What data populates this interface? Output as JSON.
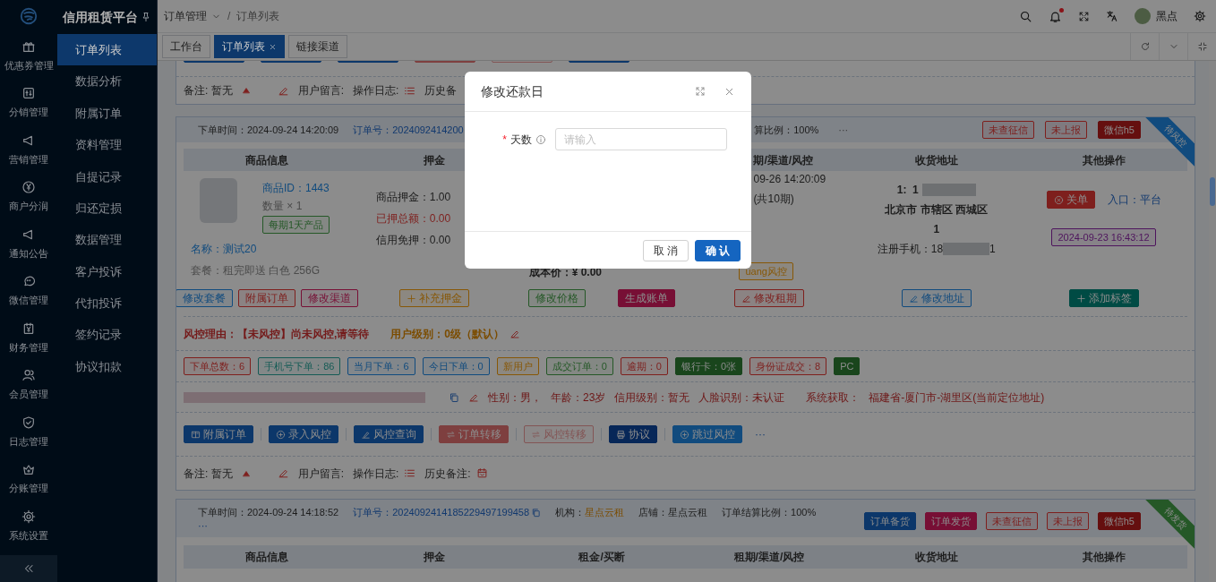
{
  "brand": {
    "title": "信用租赁平台"
  },
  "rail": [
    {
      "label": "优惠券管理"
    },
    {
      "label": "分销管理"
    },
    {
      "label": "营销管理"
    },
    {
      "label": "商户分润"
    },
    {
      "label": "通知公告"
    },
    {
      "label": "微信管理"
    },
    {
      "label": "财务管理"
    },
    {
      "label": "会员管理"
    },
    {
      "label": "日志管理"
    },
    {
      "label": "分账管理"
    },
    {
      "label": "系统设置"
    }
  ],
  "menu": [
    {
      "label": "订单列表",
      "selected": true
    },
    {
      "label": "数据分析",
      "selected": false
    },
    {
      "label": "附属订单",
      "selected": false
    },
    {
      "label": "资料管理",
      "selected": false
    },
    {
      "label": "自提记录",
      "selected": false
    },
    {
      "label": "归还定损",
      "selected": false
    },
    {
      "label": "数据管理",
      "selected": false
    },
    {
      "label": "客户投诉",
      "selected": false
    },
    {
      "label": "代扣投诉",
      "selected": false
    },
    {
      "label": "签约记录",
      "selected": false
    },
    {
      "label": "协议扣款",
      "selected": false
    }
  ],
  "breadcrumb": {
    "parent": "订单管理",
    "separator": "/",
    "current": "订单列表"
  },
  "notifications": {
    "unread": true
  },
  "user": {
    "name": "黑点"
  },
  "tabs": [
    {
      "label": "工作台",
      "selected": false
    },
    {
      "label": "订单列表",
      "selected": true
    },
    {
      "label": "链接渠道",
      "selected": false
    }
  ],
  "previous_order": {
    "buttons": [
      {
        "color": "#0c376a",
        "kind": "filled"
      },
      {
        "color": "#0c376a",
        "kind": "filled"
      },
      {
        "color": "#0c376a",
        "kind": "filled"
      },
      {
        "color": "#7e3f3f",
        "kind": "filled"
      },
      {
        "color": "#835555",
        "kind": "outline"
      },
      {
        "color": "#0c376a",
        "kind": "filled"
      }
    ],
    "remark": {
      "note": "备注: 暂无",
      "message": "用户留言:",
      "log": "操作日志:",
      "history": "历史备",
      "history_icon": false
    }
  },
  "order": {
    "header": {
      "time": "下单时间：2024-09-24 14:20:09",
      "number": "订单号：2024092414200",
      "ratio": "算比例：100%",
      "more": "···",
      "tags": [
        {
          "label": "未查征信",
          "color": "#7e1f1d",
          "kind": "outline"
        },
        {
          "label": "未上报",
          "color": "#7e1f1d",
          "kind": "outline"
        },
        {
          "label": "微信h5",
          "color": "#650f0f",
          "kind": "filled"
        }
      ],
      "ribbon": {
        "label": "待风控",
        "color": "#114b7e"
      }
    },
    "columns": {
      "column_1": "商品信息",
      "column_2": "押金",
      "column_4": "期/渠道/风控",
      "column_5": "收货地址",
      "column_6": "其他操作"
    },
    "product": {
      "id": "商品ID：1443",
      "quantity": "数量 × 1",
      "tag": {
        "label": "每期1天产品",
        "color": "#255827",
        "kind": "outline"
      },
      "name": "名称：测试20",
      "package": "套餐：租完即送 白色 256G",
      "buttons": [
        {
          "label": "修改套餐",
          "color": "#114b7e",
          "kind": "outline"
        },
        {
          "label": "附属订单",
          "color": "#7e1f1d",
          "kind": "outline"
        },
        {
          "label": "修改渠道",
          "color": "#770f35",
          "kind": "outline"
        }
      ]
    },
    "deposit": {
      "lines": [
        {
          "text": "商品押金：1.00",
          "alert": false
        },
        {
          "text": "已押总额：0.00",
          "alert": true
        },
        {
          "text": "信用免押：0.00",
          "alert": false
        }
      ],
      "buttons": [
        {
          "label": "补充押金",
          "color": "#875706",
          "kind": "outline"
        }
      ]
    },
    "rent": {
      "cost": "成本价：¥ 0.00",
      "buttons": [
        {
          "label": "修改价格",
          "color": "#255827",
          "kind": "outline"
        },
        {
          "label": "生成账单",
          "color": "#770f35",
          "kind": "filled"
        }
      ]
    },
    "term": {
      "date": "09-26 14:20:09",
      "periods": "(共10期)",
      "risk_tag": {
        "label": "uang风控",
        "color": "#875706",
        "kind": "outline"
      },
      "buttons": [
        {
          "label": "修改租期",
          "color": "#7e1f1d",
          "kind": "outline"
        }
      ]
    },
    "address": {
      "contact": "1:  1",
      "region": "北京市 市辖区 西城区",
      "detail": "1",
      "phone": "注册手机：18",
      "phone_end": "1",
      "buttons": [
        {
          "label": "修改地址",
          "color": "#114b7e",
          "kind": "outline"
        }
      ]
    },
    "actions": {
      "close": {
        "label": "关单",
        "color": "#7e1f1d",
        "kind": "filled"
      },
      "entry": "入口：平台",
      "time_tag": {
        "label": "2024-09-23 16:43:12",
        "color": "#4e145d",
        "kind": "outline"
      },
      "buttons": [
        {
          "label": "添加标签",
          "color": "#004b44",
          "kind": "filled"
        }
      ]
    },
    "risk": {
      "reason": "风控理由：【未风控】尚未风控,请等待",
      "level": "用户级别：0级（默认）"
    },
    "stats": [
      {
        "label": "下单总数：6",
        "color": "#7e1f1d",
        "kind": "outline"
      },
      {
        "label": "手机号下单：86",
        "color": "#155b55",
        "kind": "outline"
      },
      {
        "label": "当月下单：6",
        "color": "#114b7e",
        "kind": "outline"
      },
      {
        "label": "今日下单：0",
        "color": "#114b7e",
        "kind": "outline"
      },
      {
        "label": "新用户",
        "color": "#875706",
        "kind": "outline"
      },
      {
        "label": "成交订单：0",
        "color": "#255827",
        "kind": "outline"
      },
      {
        "label": "逾期：0",
        "color": "#7e1f1d",
        "kind": "outline"
      },
      {
        "label": "银行卡：0张",
        "color": "#19451c",
        "kind": "filled"
      },
      {
        "label": "身份证成交：8",
        "color": "#7e1f1d",
        "kind": "outline"
      },
      {
        "label": "PC",
        "color": "#19451c",
        "kind": "filled"
      }
    ],
    "profile": {
      "fields": [
        "性别：男，",
        "年龄：23岁",
        "信用级别：暂无",
        "人脸识别：未认证"
      ],
      "source": "系统获取：",
      "location": "福建省-厦门市-湖里区(当前定位地址)"
    },
    "operations": [
      {
        "label": "附属订单",
        "color": "#0c376a",
        "kind": "filled"
      },
      {
        "label": "录入风控",
        "color": "#0c376a",
        "kind": "filled"
      },
      {
        "label": "风控查询",
        "color": "#0c376a",
        "kind": "filled"
      },
      {
        "label": "订单转移",
        "color": "#7e3f3f",
        "kind": "filled"
      },
      {
        "label": "风控转移",
        "color": "#835555",
        "kind": "outline"
      },
      {
        "label": "协议",
        "color": "#072758",
        "kind": "filled"
      },
      {
        "label": "跳过风控",
        "color": "#114b7e",
        "kind": "filled"
      }
    ],
    "operations_more": "···",
    "remark": {
      "note": "备注: 暂无",
      "message": "用户留言:",
      "log": "操作日志:",
      "history": "历史备注:",
      "history_icon": true
    }
  },
  "next_order": {
    "header": {
      "time": "下单时间：2024-09-24 14:18:52",
      "number": "订单号：2024092414185229497199458",
      "agency_label": "机构：",
      "agency": "星点云租",
      "shop": "店铺：星点云租",
      "ratio": "订单结算比例：100%",
      "more": "···",
      "tags": [
        {
          "label": "订单备货",
          "color": "#0c376a",
          "kind": "filled"
        },
        {
          "label": "订单发货",
          "color": "#770f35",
          "kind": "filled"
        },
        {
          "label": "未查征信",
          "color": "#7e1f1d",
          "kind": "outline"
        },
        {
          "label": "未上报",
          "color": "#7e1f1d",
          "kind": "outline"
        },
        {
          "label": "微信h5",
          "color": "#650f0f",
          "kind": "filled"
        }
      ],
      "ribbon": {
        "label": "待发货",
        "color": "#255827"
      }
    },
    "columns": [
      "商品信息",
      "押金",
      "租金/买断",
      "租期/渠道/风控",
      "收货地址",
      "其他操作"
    ]
  },
  "dialog": {
    "title": "修改还款日",
    "field": {
      "required_mark": "*",
      "label": "天数",
      "placeholder": "请输入"
    },
    "buttons": [
      {
        "label": "取 消",
        "kind": "default"
      },
      {
        "label": "确 认",
        "kind": "primary"
      }
    ]
  }
}
